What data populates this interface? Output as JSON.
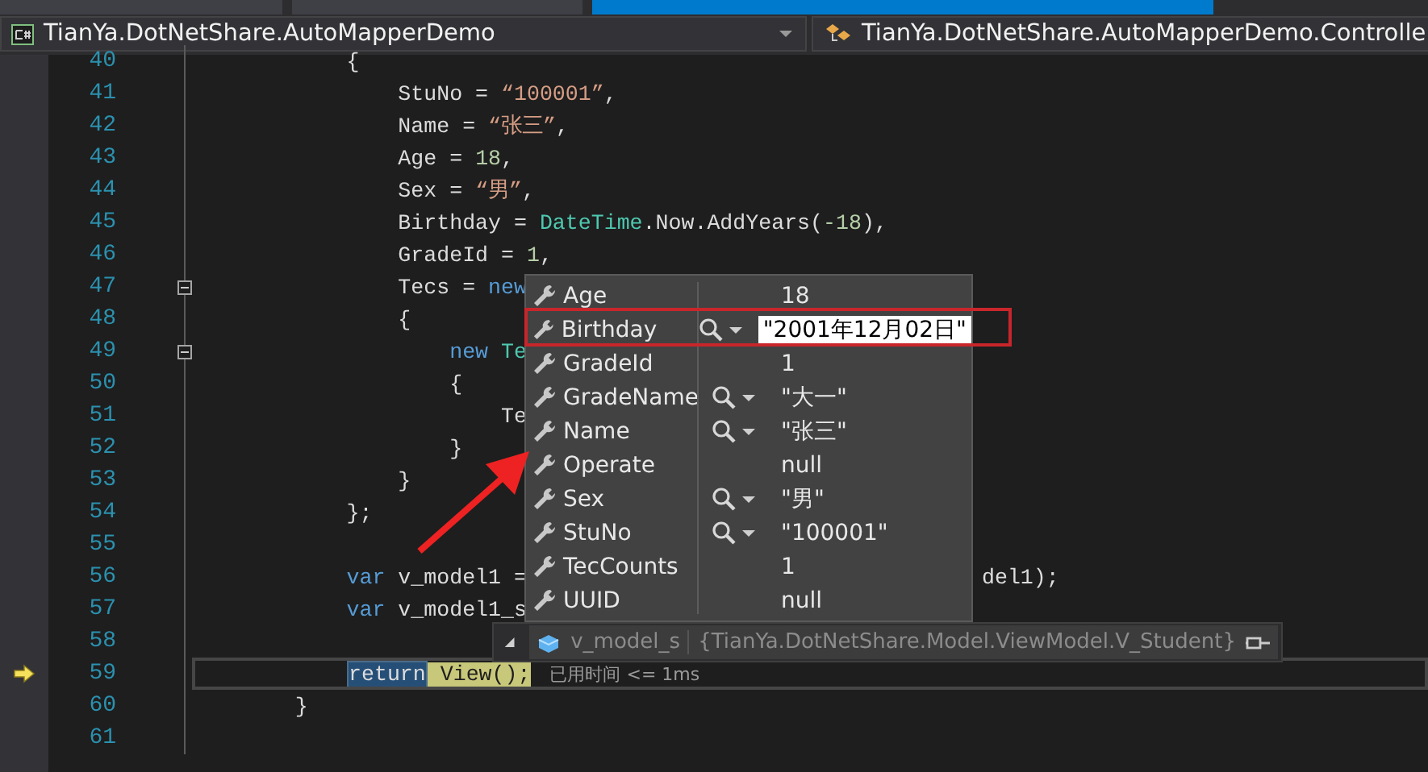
{
  "tabs": [
    {
      "selected": false
    },
    {
      "selected": false
    },
    {
      "selected": true
    }
  ],
  "navbar": {
    "project": "TianYa.DotNetShare.AutoMapperDemo",
    "member": "TianYa.DotNetShare.AutoMapperDemo.Controlle"
  },
  "code_lines": [
    {
      "number": "40",
      "collapsible": false,
      "current": false,
      "segments": [
        {
          "kind": "plain",
          "text": "            {"
        }
      ]
    },
    {
      "number": "41",
      "collapsible": false,
      "current": false,
      "segments": [
        {
          "kind": "plain",
          "text": "                StuNo = "
        },
        {
          "kind": "string",
          "text": "“100001”"
        },
        {
          "kind": "plain",
          "text": ","
        }
      ]
    },
    {
      "number": "42",
      "collapsible": false,
      "current": false,
      "segments": [
        {
          "kind": "plain",
          "text": "                Name = "
        },
        {
          "kind": "string",
          "text": "“张三”"
        },
        {
          "kind": "plain",
          "text": ","
        }
      ]
    },
    {
      "number": "43",
      "collapsible": false,
      "current": false,
      "segments": [
        {
          "kind": "plain",
          "text": "                Age = "
        },
        {
          "kind": "number",
          "text": "18"
        },
        {
          "kind": "plain",
          "text": ","
        }
      ]
    },
    {
      "number": "44",
      "collapsible": false,
      "current": false,
      "segments": [
        {
          "kind": "plain",
          "text": "                Sex = "
        },
        {
          "kind": "string",
          "text": "“男”"
        },
        {
          "kind": "plain",
          "text": ","
        }
      ]
    },
    {
      "number": "45",
      "collapsible": false,
      "current": false,
      "segments": [
        {
          "kind": "plain",
          "text": "                Birthday = "
        },
        {
          "kind": "type",
          "text": "DateTime"
        },
        {
          "kind": "plain",
          "text": ".Now.AddYears("
        },
        {
          "kind": "number",
          "text": "-18"
        },
        {
          "kind": "plain",
          "text": "),"
        }
      ]
    },
    {
      "number": "46",
      "collapsible": false,
      "current": false,
      "segments": [
        {
          "kind": "plain",
          "text": "                GradeId = "
        },
        {
          "kind": "number",
          "text": "1"
        },
        {
          "kind": "plain",
          "text": ","
        }
      ]
    },
    {
      "number": "47",
      "collapsible": true,
      "current": false,
      "segments": [
        {
          "kind": "plain",
          "text": "                Tecs = "
        },
        {
          "kind": "keyword",
          "text": "new"
        }
      ]
    },
    {
      "number": "48",
      "collapsible": false,
      "current": false,
      "segments": [
        {
          "kind": "plain",
          "text": "                {"
        }
      ]
    },
    {
      "number": "49",
      "collapsible": true,
      "current": false,
      "segments": [
        {
          "kind": "keyword",
          "text": "                    new"
        },
        {
          "kind": "type",
          "text": " Te"
        }
      ]
    },
    {
      "number": "50",
      "collapsible": false,
      "current": false,
      "segments": [
        {
          "kind": "plain",
          "text": "                    {"
        }
      ]
    },
    {
      "number": "51",
      "collapsible": false,
      "current": false,
      "segments": [
        {
          "kind": "plain",
          "text": "                        Te"
        }
      ]
    },
    {
      "number": "52",
      "collapsible": false,
      "current": false,
      "segments": [
        {
          "kind": "plain",
          "text": "                    }"
        }
      ]
    },
    {
      "number": "53",
      "collapsible": false,
      "current": false,
      "segments": [
        {
          "kind": "plain",
          "text": "                }"
        }
      ]
    },
    {
      "number": "54",
      "collapsible": false,
      "current": false,
      "segments": [
        {
          "kind": "plain",
          "text": "            };"
        }
      ]
    },
    {
      "number": "55",
      "collapsible": false,
      "current": false
    },
    {
      "number": "56",
      "collapsible": false,
      "current": false,
      "segments": [
        {
          "kind": "keyword",
          "text": "            var"
        },
        {
          "kind": "plain",
          "text": " v_model1 ="
        },
        {
          "kind": "after_popup",
          "text": "del1);"
        }
      ]
    },
    {
      "number": "57",
      "collapsible": false,
      "current": false,
      "segments": [
        {
          "kind": "keyword",
          "text": "            var"
        },
        {
          "kind": "plain",
          "text": " v_model1_s"
        }
      ]
    },
    {
      "number": "58",
      "collapsible": false,
      "current": false
    },
    {
      "number": "59",
      "collapsible": false,
      "current": true,
      "segments": [
        {
          "kind": "statement_highlight",
          "text": "return"
        },
        {
          "kind": "call_highlight",
          "text": " View();"
        },
        {
          "kind": "perf_tip",
          "text": "已用时间 <= 1ms"
        }
      ]
    },
    {
      "number": "60",
      "collapsible": false,
      "current": false,
      "segments": [
        {
          "kind": "plain",
          "text": "        }"
        }
      ]
    },
    {
      "number": "61",
      "collapsible": false,
      "current": false
    }
  ],
  "datatip": {
    "members": [
      {
        "name": "Age",
        "value": "18",
        "visualizer": false,
        "editing": false
      },
      {
        "name": "Birthday",
        "value": "\"2001年12月02日\"",
        "visualizer": true,
        "editing": true
      },
      {
        "name": "GradeId",
        "value": "1",
        "visualizer": false,
        "editing": false
      },
      {
        "name": "GradeName",
        "value": "\"大一\"",
        "visualizer": true,
        "editing": false
      },
      {
        "name": "Name",
        "value": "\"张三\"",
        "visualizer": true,
        "editing": false
      },
      {
        "name": "Operate",
        "value": "null",
        "visualizer": false,
        "editing": false
      },
      {
        "name": "Sex",
        "value": "\"男\"",
        "visualizer": true,
        "editing": false
      },
      {
        "name": "StuNo",
        "value": "\"100001\"",
        "visualizer": true,
        "editing": false
      },
      {
        "name": "TecCounts",
        "value": "1",
        "visualizer": false,
        "editing": false
      },
      {
        "name": "UUID",
        "value": "null",
        "visualizer": false,
        "editing": false
      }
    ],
    "variable": {
      "name": "v_model_s",
      "value": "{TianYa.DotNetShare.Model.ViewModel.V_Student}",
      "expanded": true
    }
  }
}
